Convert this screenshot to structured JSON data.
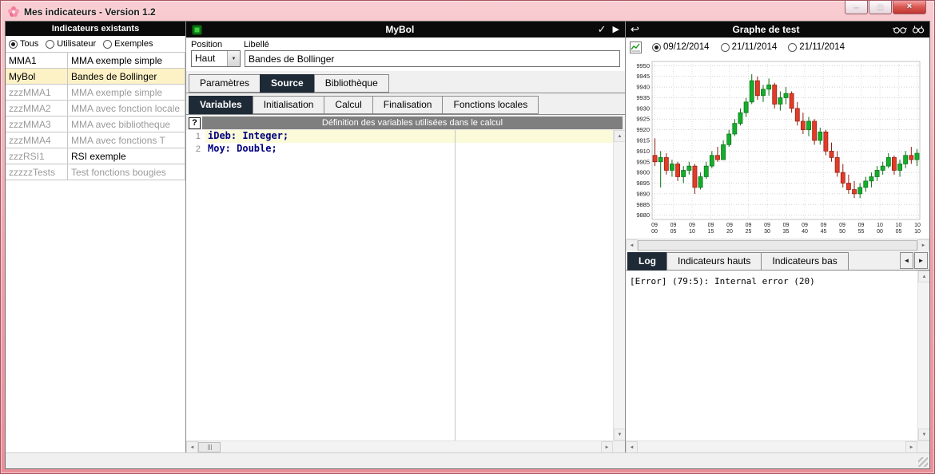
{
  "window": {
    "title": "Mes indicateurs - Version 1.2"
  },
  "icons": {
    "check": "✓",
    "play": "▶",
    "undo": "↩",
    "help": "?",
    "dropdown_arrow": "▼",
    "scroll_left": "◄",
    "scroll_right": "►",
    "scroll_up": "▲",
    "scroll_down": "▼",
    "tab_prev": "◄",
    "tab_next": "►",
    "minimize": "–",
    "maximize": "□",
    "close": "×"
  },
  "left_panel": {
    "header": "Indicateurs existants",
    "filters": [
      {
        "label": "Tous",
        "selected": true
      },
      {
        "label": "Utilisateur",
        "selected": false
      },
      {
        "label": "Exemples",
        "selected": false
      }
    ],
    "indicators": [
      {
        "name": "MMA1",
        "label": "MMA exemple simple",
        "name_muted": false,
        "label_muted": false,
        "selected": false
      },
      {
        "name": "MyBol",
        "label": "Bandes de Bollinger",
        "name_muted": false,
        "label_muted": false,
        "selected": true
      },
      {
        "name": "zzzMMA1",
        "label": "MMA exemple simple",
        "name_muted": true,
        "label_muted": true,
        "selected": false
      },
      {
        "name": "zzzMMA2",
        "label": "MMA avec fonction locale",
        "name_muted": true,
        "label_muted": true,
        "selected": false
      },
      {
        "name": "zzzMMA3",
        "label": "MMA avec bibliotheque",
        "name_muted": true,
        "label_muted": true,
        "selected": false
      },
      {
        "name": "zzzMMA4",
        "label": "MMA avec fonctions T",
        "name_muted": true,
        "label_muted": true,
        "selected": false
      },
      {
        "name": "zzzRSI1",
        "label": "RSI exemple",
        "name_muted": true,
        "label_muted": false,
        "selected": false
      },
      {
        "name": "zzzzzTests",
        "label": "Test fonctions bougies",
        "name_muted": true,
        "label_muted": true,
        "selected": false
      }
    ]
  },
  "editor_panel": {
    "title": "MyBol",
    "position_label": "Position",
    "libelle_label": "Libellé",
    "position_value": "Haut",
    "libelle_value": "Bandes de Bollinger",
    "tabs": [
      "Paramètres",
      "Source",
      "Bibliothèque"
    ],
    "active_tab": "Source",
    "source_tabs": [
      "Variables",
      "Initialisation",
      "Calcul",
      "Finalisation",
      "Fonctions locales"
    ],
    "active_source_tab": "Variables",
    "section_header": "Définition des variables utilisées dans le calcul",
    "code_lines": [
      {
        "num": "1",
        "text": "iDeb: Integer;"
      },
      {
        "num": "2",
        "text": "Moy: Double;"
      }
    ]
  },
  "graph_panel": {
    "header": "Graphe de test",
    "dates": [
      {
        "label": "09/12/2014",
        "selected": true
      },
      {
        "label": "21/11/2014",
        "selected": false
      },
      {
        "label": "21/11/2014",
        "selected": false
      }
    ],
    "tabs": [
      "Log",
      "Indicateurs hauts",
      "Indicateurs bas"
    ],
    "active_tab": "Log",
    "log_text": "[Error] (79:5): Internal error (20)"
  },
  "chart_data": {
    "type": "candlestick",
    "title": "",
    "ylim": [
      9878,
      9952
    ],
    "y_ticks": [
      9880,
      9885,
      9890,
      9895,
      9900,
      9905,
      9910,
      9915,
      9920,
      9925,
      9930,
      9935,
      9940,
      9945,
      9950
    ],
    "x_ticks": [
      [
        "09",
        "00"
      ],
      [
        "09",
        "05"
      ],
      [
        "09",
        "10"
      ],
      [
        "09",
        "15"
      ],
      [
        "09",
        "20"
      ],
      [
        "09",
        "25"
      ],
      [
        "09",
        "30"
      ],
      [
        "09",
        "35"
      ],
      [
        "09",
        "40"
      ],
      [
        "09",
        "45"
      ],
      [
        "09",
        "50"
      ],
      [
        "09",
        "55"
      ],
      [
        "10",
        "00"
      ],
      [
        "10",
        "05"
      ],
      [
        "10",
        "10"
      ]
    ],
    "grid": true,
    "up_color": "#14ad2c",
    "down_color": "#e23b28",
    "candles": [
      [
        9908,
        9916,
        9903,
        9905
      ],
      [
        9905,
        9910,
        9893,
        9907
      ],
      [
        9907,
        9909,
        9899,
        9901
      ],
      [
        9901,
        9906,
        9898,
        9904
      ],
      [
        9904,
        9905,
        9896,
        9898
      ],
      [
        9898,
        9903,
        9895,
        9901
      ],
      [
        9901,
        9905,
        9899,
        9903
      ],
      [
        9903,
        9904,
        9890,
        9893
      ],
      [
        9893,
        9900,
        9892,
        9898
      ],
      [
        9898,
        9905,
        9897,
        9903
      ],
      [
        9903,
        9910,
        9902,
        9908
      ],
      [
        9908,
        9912,
        9905,
        9906
      ],
      [
        9906,
        9915,
        9906,
        9913
      ],
      [
        9913,
        9920,
        9912,
        9918
      ],
      [
        9918,
        9925,
        9917,
        9923
      ],
      [
        9923,
        9930,
        9922,
        9928
      ],
      [
        9928,
        9935,
        9926,
        9933
      ],
      [
        9933,
        9946,
        9932,
        9943
      ],
      [
        9943,
        9945,
        9934,
        9936
      ],
      [
        9936,
        9941,
        9933,
        9939
      ],
      [
        9939,
        9944,
        9936,
        9941
      ],
      [
        9941,
        9942,
        9930,
        9932
      ],
      [
        9932,
        9938,
        9929,
        9935
      ],
      [
        9935,
        9940,
        9932,
        9937
      ],
      [
        9937,
        9938,
        9928,
        9930
      ],
      [
        9930,
        9933,
        9922,
        9924
      ],
      [
        9924,
        9928,
        9918,
        9920
      ],
      [
        9920,
        9926,
        9917,
        9924
      ],
      [
        9924,
        9925,
        9913,
        9915
      ],
      [
        9915,
        9921,
        9913,
        9919
      ],
      [
        9919,
        9920,
        9908,
        9910
      ],
      [
        9910,
        9914,
        9905,
        9907
      ],
      [
        9907,
        9910,
        9898,
        9900
      ],
      [
        9900,
        9904,
        9893,
        9895
      ],
      [
        9895,
        9899,
        9890,
        9892
      ],
      [
        9892,
        9896,
        9888,
        9890
      ],
      [
        9890,
        9895,
        9888,
        9893
      ],
      [
        9893,
        9898,
        9891,
        9896
      ],
      [
        9896,
        9900,
        9893,
        9898
      ],
      [
        9898,
        9903,
        9896,
        9901
      ],
      [
        9901,
        9905,
        9899,
        9903
      ],
      [
        9903,
        9909,
        9902,
        9907
      ],
      [
        9907,
        9908,
        9899,
        9901
      ],
      [
        9901,
        9906,
        9898,
        9904
      ],
      [
        9904,
        9910,
        9902,
        9908
      ],
      [
        9908,
        9912,
        9904,
        9906
      ],
      [
        9906,
        9911,
        9903,
        9909
      ]
    ]
  }
}
